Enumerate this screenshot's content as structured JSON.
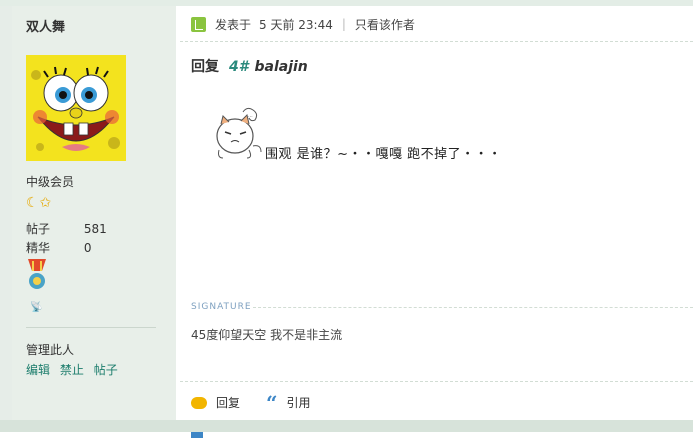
{
  "user": {
    "name": "双人舞",
    "rank": "中级会员",
    "stars": "☾✩",
    "stats": [
      {
        "label": "帖子",
        "value": "581"
      },
      {
        "label": "精华",
        "value": "0"
      }
    ],
    "manage_title": "管理此人",
    "manage_links": [
      "编辑",
      "禁止",
      "帖子"
    ]
  },
  "post": {
    "posted_prefix": "发表于",
    "posted_time": "5 天前 23:44",
    "separator": "|",
    "only_author": "只看该作者",
    "reply_label": "回复",
    "floor": "4#",
    "reply_to": "balajin",
    "content": "围观 是谁？~・・嘎嘎 跑不掉了・・・",
    "signature_label": "SIGNATURE",
    "signature": "45度仰望天空 我不是非主流",
    "actions": {
      "reply": "回复",
      "quote": "引用"
    }
  },
  "colors": {
    "sidebar_bg": "#e8efe9",
    "link": "#1c7d6c",
    "accent_green": "#8ac43f"
  }
}
